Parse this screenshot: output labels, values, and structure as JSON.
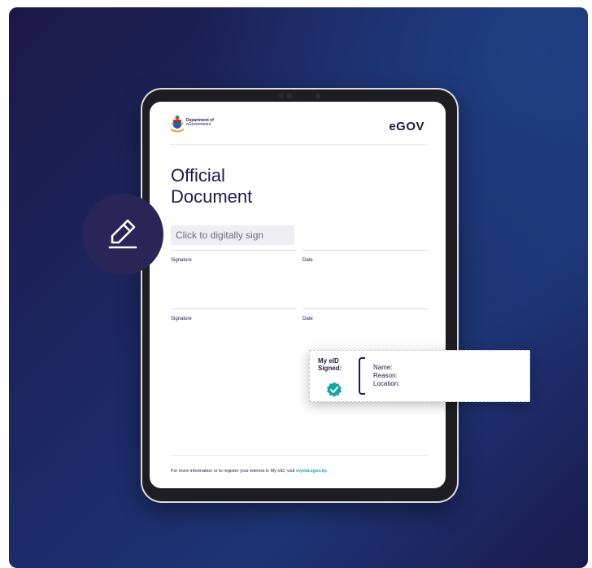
{
  "document": {
    "department_line1": "Department of",
    "department_line2": "eGovernment",
    "brand": "eGOV",
    "title_line1": "Official",
    "title_line2": "Document",
    "sign_placeholder": "Click to digitally sign",
    "signature_label": "Signature",
    "date_label": "Date",
    "footer_text": "For more information or to register your interest in My eID, visit",
    "footer_link": "myeid.egov.ky."
  },
  "stamp": {
    "title": "My eID Signed:",
    "name_label": "Name:",
    "reason_label": "Reason:",
    "location_label": "Location:"
  },
  "colors": {
    "navy": "#1e1a45",
    "teal": "#14a5a5",
    "background_gradient_start": "#1d1848",
    "background_gradient_end": "#1d3474"
  }
}
